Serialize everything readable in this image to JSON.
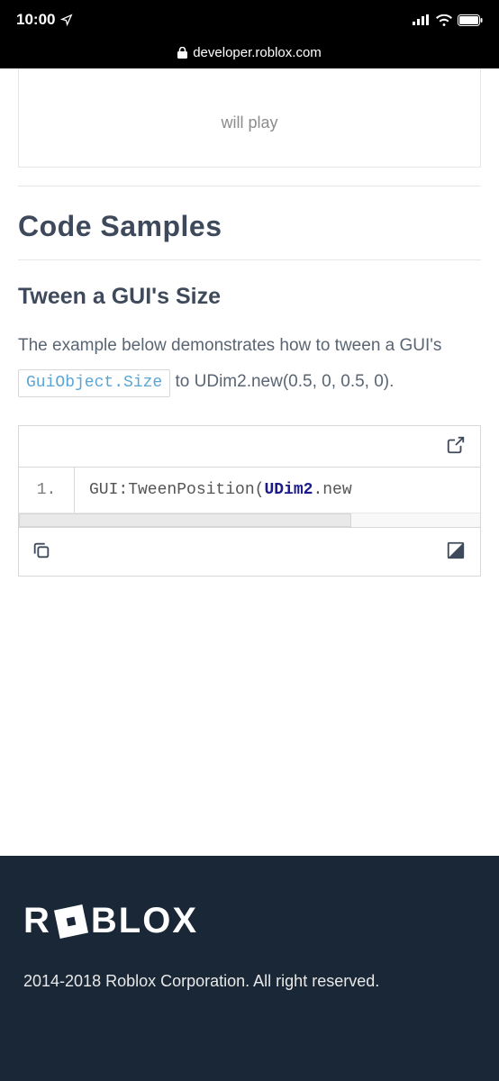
{
  "status": {
    "time": "10:00",
    "domain": "developer.roblox.com"
  },
  "partial": {
    "text": "will play"
  },
  "sections": {
    "code_samples_heading": "Code Samples",
    "tween_heading": "Tween a GUI's Size",
    "para_before": "The example below demonstrates how to tween a GUI's ",
    "code_chip": "GuiObject.Size",
    "para_after": " to UDim2.new(0.5, 0, 0.5, 0)."
  },
  "code": {
    "line_number": "1.",
    "segments": {
      "a": "GUI:TweenPosition(",
      "b": "UDim2",
      "c": ".new"
    }
  },
  "footer": {
    "brand_r": "R",
    "brand_rest": "BLOX",
    "copyright": "2014-2018 Roblox Corporation. All right reserved."
  }
}
